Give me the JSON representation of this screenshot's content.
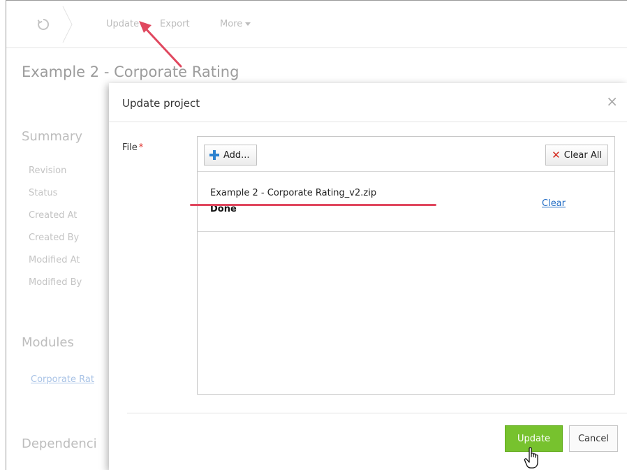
{
  "toolbar": {
    "refresh_icon": "refresh-icon",
    "update_label": "Update",
    "export_label": "Export",
    "more_label": "More"
  },
  "page": {
    "title": "Example 2 - Corporate Rating",
    "summary_heading": "Summary",
    "fields": [
      "Revision",
      "Status",
      "Created At",
      "Created By",
      "Modified At",
      "Modified By"
    ],
    "modules_heading": "Modules",
    "module_link": "Corporate Rat",
    "dependencies_heading": "Dependenci"
  },
  "dialog": {
    "title": "Update project",
    "close_label": "×",
    "file_label": "File",
    "required_mark": "*",
    "add_label": "Add...",
    "clear_all_label": "Clear All",
    "files": [
      {
        "name": "Example 2 - Corporate Rating_v2.zip",
        "status": "Done",
        "clear_label": "Clear"
      }
    ],
    "update_label": "Update",
    "cancel_label": "Cancel"
  },
  "colors": {
    "primary_button": "#77c22e",
    "annotation": "#e0485f",
    "link": "#1f6bc4",
    "required": "#e0322e"
  }
}
